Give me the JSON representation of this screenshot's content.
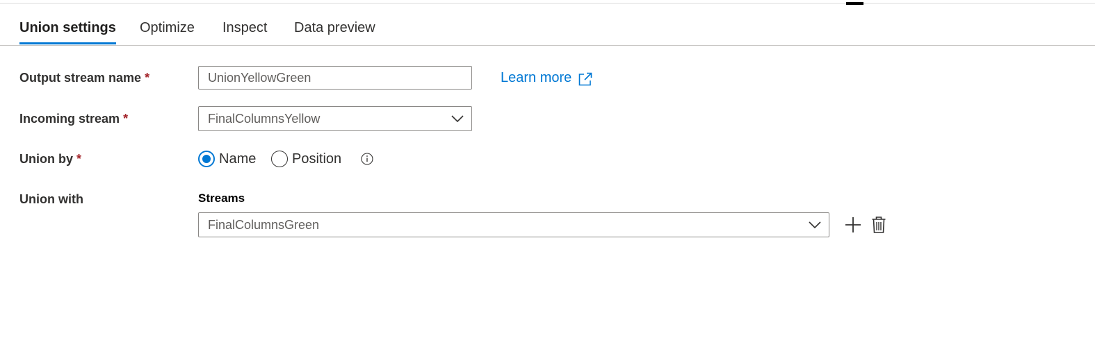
{
  "tabs": [
    {
      "label": "Union settings",
      "active": true
    },
    {
      "label": "Optimize",
      "active": false
    },
    {
      "label": "Inspect",
      "active": false
    },
    {
      "label": "Data preview",
      "active": false
    }
  ],
  "form": {
    "required_marker": "*",
    "output_stream": {
      "label": "Output stream name",
      "value": "UnionYellowGreen"
    },
    "learn_more": {
      "label": "Learn more",
      "icon": "external-link-icon"
    },
    "incoming_stream": {
      "label": "Incoming stream",
      "selected": "FinalColumnsYellow"
    },
    "union_by": {
      "label": "Union by",
      "options": [
        {
          "label": "Name",
          "checked": true
        },
        {
          "label": "Position",
          "checked": false
        }
      ],
      "info_icon": "info-icon"
    },
    "union_with": {
      "label": "Union with",
      "streams_header": "Streams",
      "stream_selected": "FinalColumnsGreen",
      "add_icon": "plus-icon",
      "delete_icon": "trash-icon"
    }
  },
  "colors": {
    "accent": "#0078d4",
    "required": "#a4262c",
    "text": "#323130",
    "border": "#8a8886"
  }
}
